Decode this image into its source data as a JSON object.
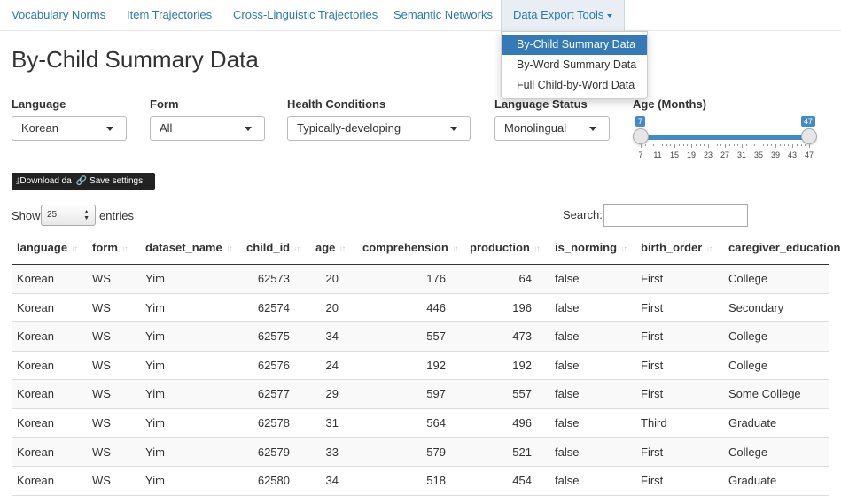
{
  "navbar": {
    "items": [
      {
        "label": "Vocabulary Norms"
      },
      {
        "label": "Item Trajectories"
      },
      {
        "label": "Cross-Linguistic Trajectories"
      },
      {
        "label": "Semantic Networks"
      },
      {
        "label": "Data Export Tools"
      }
    ]
  },
  "dropdown": {
    "items": [
      {
        "label": "By-Child Summary Data",
        "selected": true
      },
      {
        "label": "By-Word Summary Data"
      },
      {
        "label": "Full Child-by-Word Data"
      }
    ]
  },
  "page": {
    "title": "By-Child Summary Data"
  },
  "filters": {
    "language": {
      "label": "Language",
      "value": "Korean"
    },
    "form": {
      "label": "Form",
      "value": "All"
    },
    "health": {
      "label": "Health Conditions",
      "value": "Typically-developing"
    },
    "status": {
      "label": "Language Status",
      "value": "Monolingual"
    },
    "age": {
      "label": "Age (Months)",
      "min_value": "7",
      "max_value": "47",
      "ticks": [
        "7",
        "11",
        "15",
        "19",
        "23",
        "27",
        "31",
        "35",
        "39",
        "43",
        "47"
      ]
    }
  },
  "buttons": {
    "download": "Download da",
    "save": "Save settings"
  },
  "table_controls": {
    "show": "Show",
    "length": "25",
    "entries": "entries",
    "search": "Search:"
  },
  "table": {
    "columns": [
      "language",
      "form",
      "dataset_name",
      "child_id",
      "age",
      "comprehension",
      "production",
      "is_norming",
      "birth_order",
      "caregiver_education"
    ],
    "rows": [
      [
        "Korean",
        "WS",
        "Yim",
        "62573",
        "20",
        "176",
        "64",
        "false",
        "First",
        "College"
      ],
      [
        "Korean",
        "WS",
        "Yim",
        "62574",
        "20",
        "446",
        "196",
        "false",
        "First",
        "Secondary"
      ],
      [
        "Korean",
        "WS",
        "Yim",
        "62575",
        "34",
        "557",
        "473",
        "false",
        "First",
        "College"
      ],
      [
        "Korean",
        "WS",
        "Yim",
        "62576",
        "24",
        "192",
        "192",
        "false",
        "First",
        "College"
      ],
      [
        "Korean",
        "WS",
        "Yim",
        "62577",
        "29",
        "597",
        "557",
        "false",
        "First",
        "Some College"
      ],
      [
        "Korean",
        "WS",
        "Yim",
        "62578",
        "31",
        "564",
        "496",
        "false",
        "Third",
        "Graduate"
      ],
      [
        "Korean",
        "WS",
        "Yim",
        "62579",
        "33",
        "579",
        "521",
        "false",
        "First",
        "College"
      ],
      [
        "Korean",
        "WS",
        "Yim",
        "62580",
        "34",
        "518",
        "454",
        "false",
        "First",
        "Graduate"
      ]
    ]
  }
}
